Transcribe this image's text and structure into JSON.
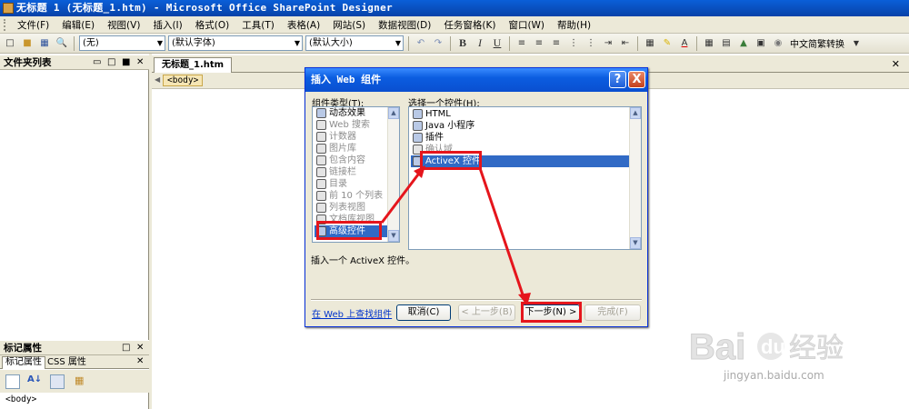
{
  "window": {
    "title": "无标题 1 (无标题_1.htm) - Microsoft Office SharePoint Designer"
  },
  "menu": [
    "文件(F)",
    "编辑(E)",
    "视图(V)",
    "插入(I)",
    "格式(O)",
    "工具(T)",
    "表格(A)",
    "网站(S)",
    "数据视图(D)",
    "任务窗格(K)",
    "窗口(W)",
    "帮助(H)"
  ],
  "toolbar": {
    "style_value": "(无)",
    "font_value": "(默认字体)",
    "size_value": "(默认大小)",
    "bold": "B",
    "italic": "I",
    "underline": "U",
    "convert_label": "中文简繁转换"
  },
  "folder_pane": {
    "title": "文件夹列表"
  },
  "tag_pane": {
    "title": "标记属性",
    "tab_tag": "标记属性",
    "tab_css": "CSS 属性",
    "body_tag": "<body>"
  },
  "document": {
    "tab_label": "无标题_1.htm",
    "breadcrumb_tag": "<body>"
  },
  "dialog": {
    "title": "插入 Web 组件",
    "help": "?",
    "close": "X",
    "category_label": "组件类型(T):",
    "control_label": "选择一个控件(H):",
    "categories": [
      {
        "label": "动态效果",
        "dim": false
      },
      {
        "label": "Web 搜索",
        "dim": true
      },
      {
        "label": "计数器",
        "dim": true
      },
      {
        "label": "图片库",
        "dim": true
      },
      {
        "label": "包含内容",
        "dim": true
      },
      {
        "label": "链接栏",
        "dim": true
      },
      {
        "label": "目录",
        "dim": true
      },
      {
        "label": "前 10 个列表",
        "dim": true
      },
      {
        "label": "列表视图",
        "dim": true
      },
      {
        "label": "文档库视图",
        "dim": true
      },
      {
        "label": "高级控件",
        "dim": false,
        "selected": true
      }
    ],
    "controls": [
      {
        "label": "HTML",
        "dim": false
      },
      {
        "label": "Java 小程序",
        "dim": false
      },
      {
        "label": "插件",
        "dim": false
      },
      {
        "label": "确认域",
        "dim": true
      },
      {
        "label": "ActiveX 控件",
        "dim": false,
        "selected": true
      }
    ],
    "description": "插入一个 ActiveX 控件。",
    "find_link": "在 Web 上查找组件",
    "btn_cancel": "取消(C)",
    "btn_back": "< 上一步(B)",
    "btn_next": "下一步(N) >",
    "btn_finish": "完成(F)"
  },
  "watermark": {
    "logo": "Bai du 经验",
    "url": "jingyan.baidu.com"
  },
  "colors": {
    "selection": "#316ac5",
    "annotation": "#e5151c",
    "title_bar": "#0a5fd8"
  }
}
